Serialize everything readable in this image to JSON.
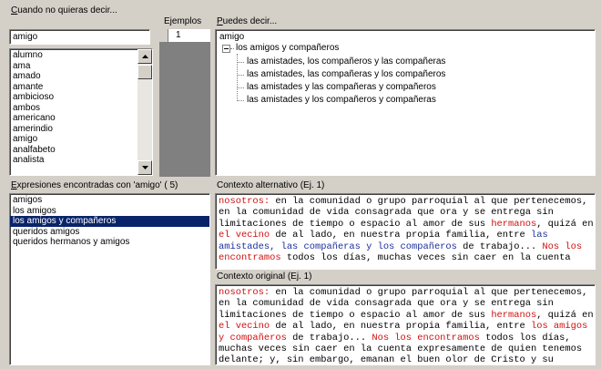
{
  "left_top": {
    "label": "Cuando no quieras decir...",
    "label_u": "C",
    "search_value": "amigo",
    "words": [
      "alumno",
      "ama",
      "amado",
      "amante",
      "ambicioso",
      "ambos",
      "americano",
      "amerindio",
      "amigo",
      "analfabeto",
      "analista"
    ]
  },
  "examples": {
    "label": "Ejemplos",
    "value": "1"
  },
  "right_top": {
    "label": "Puedes decir...",
    "label_u": "P",
    "root": "amigo",
    "node": "los amigos y compañeros",
    "children": [
      "las amistades, los compañeros y las compañeras",
      "las amistades, las compañeras y los compañeros",
      "las amistades y las compañeras y compañeros",
      "las amistades y los compañeros y compañeras"
    ]
  },
  "left_bottom": {
    "label": "Expresiones encontradas con 'amigo' ( 5)",
    "label_u": "E",
    "items": [
      "amigos",
      "los amigos",
      "los amigos y compañeros",
      "queridos amigos",
      "queridos hermanos y amigos"
    ],
    "selected_index": 2
  },
  "alt_context": {
    "label": "Contexto alternativo (Ej. 1)",
    "segments": [
      {
        "t": "nosotros:",
        "c": "red"
      },
      {
        "t": " en la comunidad o grupo parroquial al que pertenecemos,",
        "c": ""
      },
      {
        "t": "\n",
        "c": ""
      },
      {
        "t": "en la comunidad de vida consagrada que ora y se entrega sin",
        "c": ""
      },
      {
        "t": "\n",
        "c": ""
      },
      {
        "t": "limitaciones de tiempo o espacio al amor de sus ",
        "c": ""
      },
      {
        "t": "hermanos",
        "c": "red"
      },
      {
        "t": ", quizá en",
        "c": ""
      },
      {
        "t": "\n",
        "c": ""
      },
      {
        "t": "el vecino",
        "c": "red"
      },
      {
        "t": " de al lado, en nuestra propia familia, entre ",
        "c": ""
      },
      {
        "t": "las",
        "c": "blue"
      },
      {
        "t": "\n",
        "c": ""
      },
      {
        "t": "amistades, las compañeras y los compañeros",
        "c": "blue"
      },
      {
        "t": " de trabajo... ",
        "c": ""
      },
      {
        "t": "Nos los",
        "c": "red"
      },
      {
        "t": "\n",
        "c": ""
      },
      {
        "t": "encontramos",
        "c": "red"
      },
      {
        "t": " todos los días, muchas veces sin caer en la cuenta",
        "c": ""
      }
    ]
  },
  "orig_context": {
    "label": "Contexto original (Ej. 1)",
    "segments": [
      {
        "t": "nosotros:",
        "c": "red"
      },
      {
        "t": " en la comunidad o grupo parroquial al que pertenecemos,",
        "c": ""
      },
      {
        "t": "\n",
        "c": ""
      },
      {
        "t": "en la comunidad de vida consagrada que ora y se entrega sin",
        "c": ""
      },
      {
        "t": "\n",
        "c": ""
      },
      {
        "t": "limitaciones de tiempo o espacio al amor de sus ",
        "c": ""
      },
      {
        "t": "hermanos",
        "c": "red"
      },
      {
        "t": ", quizá en",
        "c": ""
      },
      {
        "t": "\n",
        "c": ""
      },
      {
        "t": "el vecino",
        "c": "red"
      },
      {
        "t": " de al lado, en nuestra propia familia, entre ",
        "c": ""
      },
      {
        "t": "los amigos",
        "c": "red"
      },
      {
        "t": "\n",
        "c": ""
      },
      {
        "t": "y compañeros",
        "c": "red"
      },
      {
        "t": " de trabajo... ",
        "c": ""
      },
      {
        "t": "Nos los encontramos",
        "c": "red"
      },
      {
        "t": " todos los días,",
        "c": ""
      },
      {
        "t": "\n",
        "c": ""
      },
      {
        "t": "muchas veces sin caer en la cuenta expresamente de quien tenemos",
        "c": ""
      },
      {
        "t": "\n",
        "c": ""
      },
      {
        "t": "delante; y, sin embargo, emanan el buen olor de Cristo y su",
        "c": ""
      }
    ]
  },
  "colors": {
    "red": "#d01010",
    "blue": "#1c2e9c",
    "selection": "#0a246a",
    "face": "#d4d0c8"
  }
}
